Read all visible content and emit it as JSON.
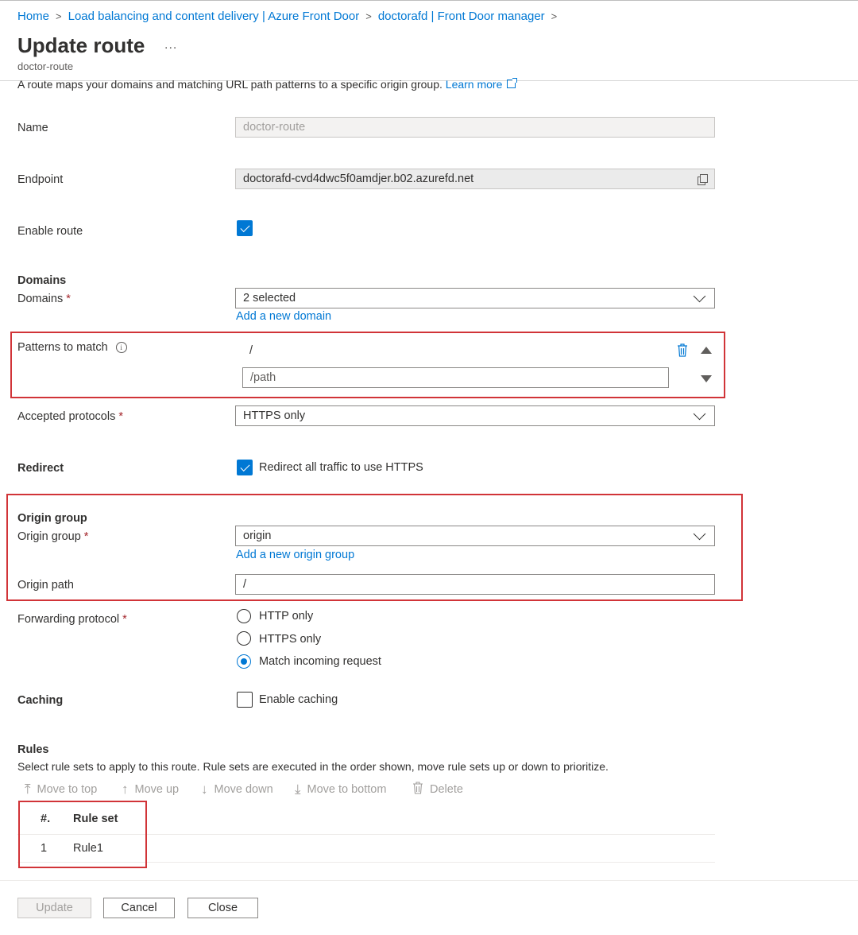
{
  "breadcrumb": {
    "items": [
      "Home",
      "Load balancing and content delivery | Azure Front Door",
      "doctorafd | Front Door manager"
    ],
    "separator": ">"
  },
  "header": {
    "title": "Update route",
    "more_label": "...",
    "subtitle": "doctor-route"
  },
  "description": {
    "text": "A route maps your domains and matching URL path patterns to a specific origin group.",
    "learn_more": "Learn more"
  },
  "form": {
    "name": {
      "label": "Name",
      "value": "doctor-route"
    },
    "endpoint": {
      "label": "Endpoint",
      "value": "doctorafd-cvd4dwc5f0amdjer.b02.azurefd.net"
    },
    "enable_route": {
      "label": "Enable route",
      "checked": true
    },
    "domains_section": "Domains",
    "domains": {
      "label": "Domains",
      "required": "*",
      "value": "2 selected",
      "add_link": "Add a new domain"
    },
    "patterns": {
      "label": "Patterns to match",
      "info": "i",
      "existing": "/",
      "placeholder": "/path"
    },
    "protocols": {
      "label": "Accepted protocols",
      "required": "*",
      "value": "HTTPS only"
    },
    "redirect": {
      "label": "Redirect",
      "checkbox_label": "Redirect all traffic to use HTTPS",
      "checked": true
    },
    "origin_section": "Origin group",
    "origin_group": {
      "label": "Origin group",
      "required": "*",
      "value": "origin",
      "add_link": "Add a new origin group"
    },
    "origin_path": {
      "label": "Origin path",
      "value": "/"
    },
    "forwarding": {
      "label": "Forwarding protocol",
      "required": "*",
      "options": [
        "HTTP only",
        "HTTPS only",
        "Match incoming request"
      ],
      "selected": "Match incoming request"
    },
    "caching": {
      "label": "Caching",
      "checkbox_label": "Enable caching",
      "checked": false
    }
  },
  "rules": {
    "title": "Rules",
    "description": "Select rule sets to apply to this route. Rule sets are executed in the order shown, move rule sets up or down to prioritize.",
    "toolbar": [
      "Move to top",
      "Move up",
      "Move down",
      "Move to bottom",
      "Delete"
    ],
    "columns": [
      "#.",
      "Rule set"
    ],
    "rows": [
      {
        "num": "1",
        "rule_set": "Rule1"
      }
    ]
  },
  "footer": {
    "update": "Update",
    "cancel": "Cancel",
    "close": "Close"
  },
  "colors": {
    "accent": "#0078d4",
    "highlight_border": "#d13438",
    "required": "#a4262c"
  }
}
